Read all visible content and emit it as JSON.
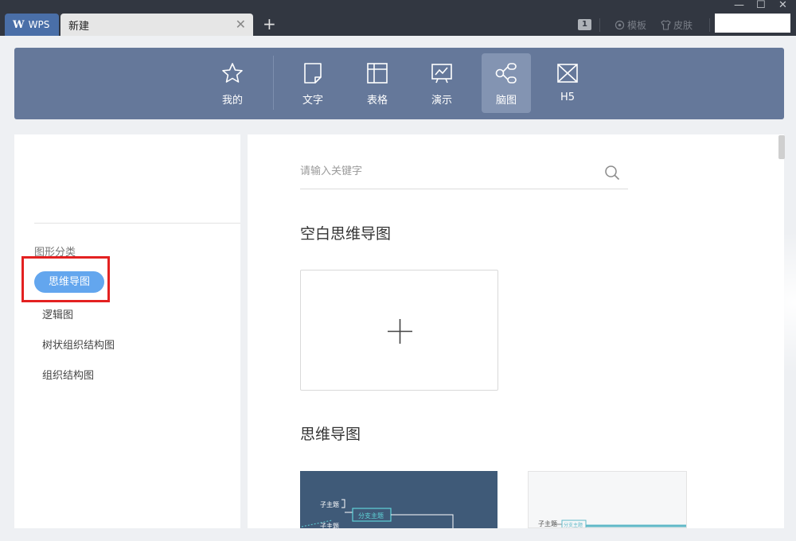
{
  "titlebar": {
    "tabs": [
      {
        "logo": "W",
        "label": "WPS"
      },
      {
        "label": "新建",
        "close": "✕"
      }
    ],
    "add_tab": "+",
    "badge": "1",
    "template_label": "模板",
    "skin_label": "皮肤",
    "window_controls": {
      "minimize": "—",
      "maximize": "☐",
      "close": "✕"
    }
  },
  "categories": [
    {
      "label": "我的",
      "icon": "star-icon"
    },
    {
      "label": "文字",
      "icon": "document-icon"
    },
    {
      "label": "表格",
      "icon": "spreadsheet-icon"
    },
    {
      "label": "演示",
      "icon": "presentation-icon"
    },
    {
      "label": "脑图",
      "icon": "mindmap-icon",
      "active": true
    },
    {
      "label": "H5",
      "icon": "h5-icon"
    }
  ],
  "sidebar": {
    "section_title": "图形分类",
    "items": [
      {
        "label": "思维导图",
        "active": true
      },
      {
        "label": "逻辑图"
      },
      {
        "label": "树状组织结构图"
      },
      {
        "label": "组织结构图"
      }
    ]
  },
  "main": {
    "search_placeholder": "请输入关键字",
    "blank_section_title": "空白思维导图",
    "mindmap_section_title": "思维导图",
    "template1": {
      "node_child1": "子主题",
      "node_branch": "分支主题",
      "node_child2": "子主题"
    },
    "template2": {
      "node_child": "子主题",
      "node_branch": "分支主题"
    }
  },
  "colors": {
    "titlebar": "#323741",
    "category_bar": "#65789a",
    "active_item": "#63a6ee",
    "highlight_box": "#e32121"
  }
}
